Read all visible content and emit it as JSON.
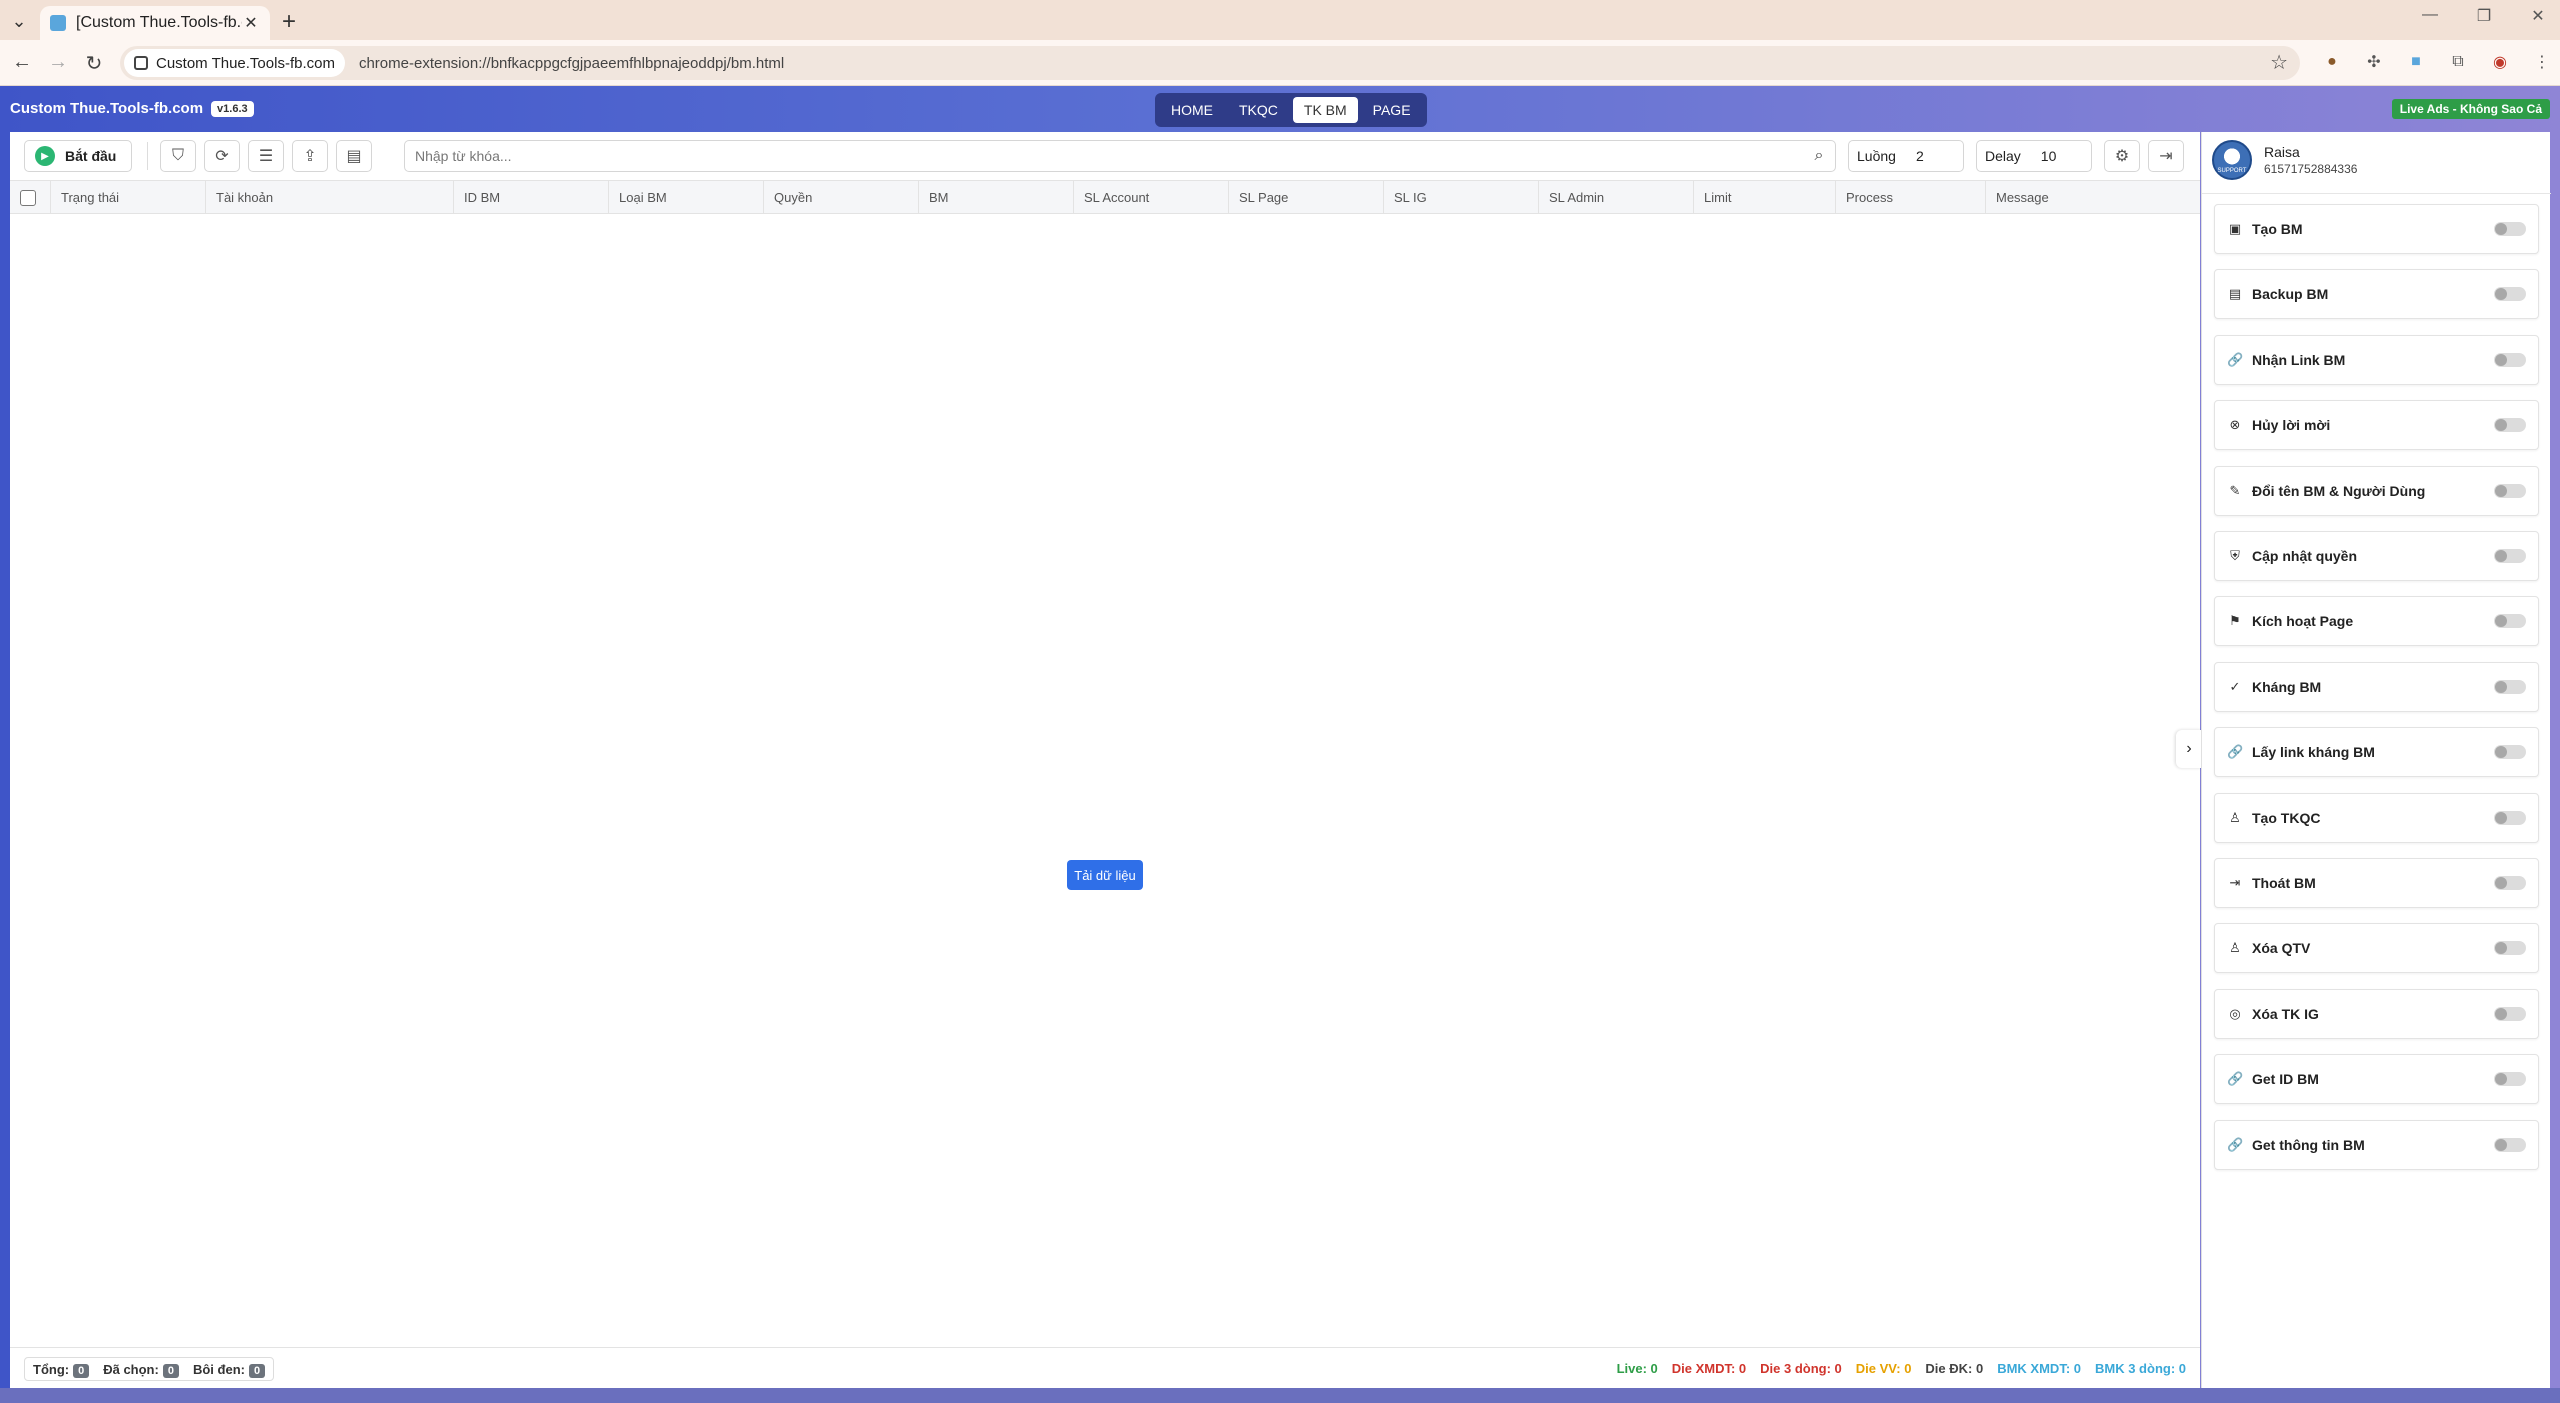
{
  "browser": {
    "tab_title": "[Custom Thue.Tools-fb.com] Q",
    "site_chip": "Custom Thue.Tools-fb.com",
    "url": "chrome-extension://bnfkacppgcfgjpaeemfhlbpnajeoddpj/bm.html"
  },
  "app": {
    "brand": "Custom Thue.Tools-fb.com",
    "version": "v1.6.3",
    "nav": [
      {
        "label": "HOME",
        "active": false
      },
      {
        "label": "TKQC",
        "active": false
      },
      {
        "label": "TK BM",
        "active": true
      },
      {
        "label": "PAGE",
        "active": false
      }
    ],
    "live_badge": "Live Ads - Không Sao Cả"
  },
  "toolbar": {
    "start_label": "Bắt đầu",
    "search_placeholder": "Nhập từ khóa...",
    "threads_label": "Luồng",
    "threads_value": "2",
    "delay_label": "Delay",
    "delay_value": "10"
  },
  "table": {
    "columns": [
      "Trạng thái",
      "Tài khoản",
      "ID BM",
      "Loại BM",
      "Quyền",
      "BM",
      "SL Account",
      "SL Page",
      "SL IG",
      "SL Admin",
      "Limit",
      "Process",
      "Message"
    ],
    "load_button": "Tải dữ liệu"
  },
  "footer": {
    "total_label": "Tổng:",
    "total_value": "0",
    "selected_label": "Đã chọn:",
    "selected_value": "0",
    "highlighted_label": "Bôi đen:",
    "highlighted_value": "0",
    "stats": [
      {
        "label": "Live: 0",
        "color": "#2e9d47"
      },
      {
        "label": "Die XMDT: 0",
        "color": "#d0342c"
      },
      {
        "label": "Die 3 dòng: 0",
        "color": "#d0342c"
      },
      {
        "label": "Die VV: 0",
        "color": "#e6a100"
      },
      {
        "label": "Die ĐK: 0",
        "color": "#444444"
      },
      {
        "label": "BMK XMDT: 0",
        "color": "#3aa8d8"
      },
      {
        "label": "BMK 3 dòng: 0",
        "color": "#3aa8d8"
      }
    ]
  },
  "profile": {
    "name": "Raisa",
    "id": "61571752884336",
    "avatar_text": "SUPPORT"
  },
  "features": [
    {
      "label": "Tạo BM",
      "icon": "briefcase-icon"
    },
    {
      "label": "Backup BM",
      "icon": "archive-icon"
    },
    {
      "label": "Nhận Link BM",
      "icon": "link-icon"
    },
    {
      "label": "Hủy lời mời",
      "icon": "circle-x-icon"
    },
    {
      "label": "Đổi tên BM & Người Dùng",
      "icon": "pencil-icon"
    },
    {
      "label": "Cập nhật quyền",
      "icon": "shield-icon"
    },
    {
      "label": "Kích hoạt Page",
      "icon": "flag-icon"
    },
    {
      "label": "Kháng BM",
      "icon": "shield-check-icon"
    },
    {
      "label": "Lấy link kháng BM",
      "icon": "link-icon"
    },
    {
      "label": "Tạo TKQC",
      "icon": "user-icon"
    },
    {
      "label": "Thoát BM",
      "icon": "logout-icon"
    },
    {
      "label": "Xóa QTV",
      "icon": "user-icon"
    },
    {
      "label": "Xóa TK IG",
      "icon": "instagram-icon"
    },
    {
      "label": "Get ID BM",
      "icon": "link-icon"
    },
    {
      "label": "Get thông tin BM",
      "icon": "link-icon"
    }
  ]
}
